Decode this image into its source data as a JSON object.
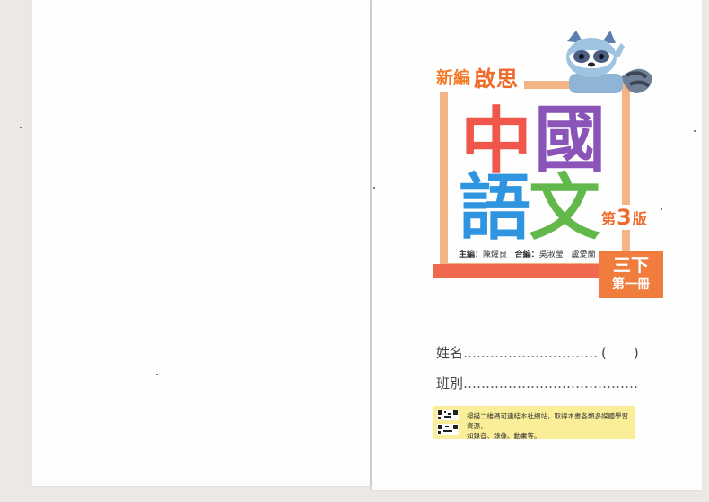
{
  "cover": {
    "series_new": "新編",
    "series_name": "啟思",
    "title_chars": [
      "中",
      "國",
      "語",
      "文"
    ],
    "edition_prefix": "第",
    "edition_number": "3",
    "edition_suffix": "版",
    "grade_top": "三下",
    "grade_bottom": "第一冊",
    "editor_label": "主編：",
    "editor_name": "陳燿良",
    "co_editor_label": "合編：",
    "co_editor_names": "吳淑瑩　盧愛蘭"
  },
  "form": {
    "name_label": "姓名",
    "name_dots": "…………………………",
    "name_paren": "(　　)",
    "class_label": "班別",
    "class_dots": "…………………………………"
  },
  "qr_note": {
    "line1": "掃描二維碼可連結本社網站，取得本書各類多媒體學習資源，",
    "line2": "如錄音、錄像、動畫等。"
  },
  "colors": {
    "frame": "#f3b486",
    "char_1": "#f0564a",
    "char_2": "#8b54b8",
    "char_3": "#2f95e0",
    "char_4": "#63b84b",
    "accent_orange": "#f06a2a",
    "note_bg": "#fbee98"
  }
}
